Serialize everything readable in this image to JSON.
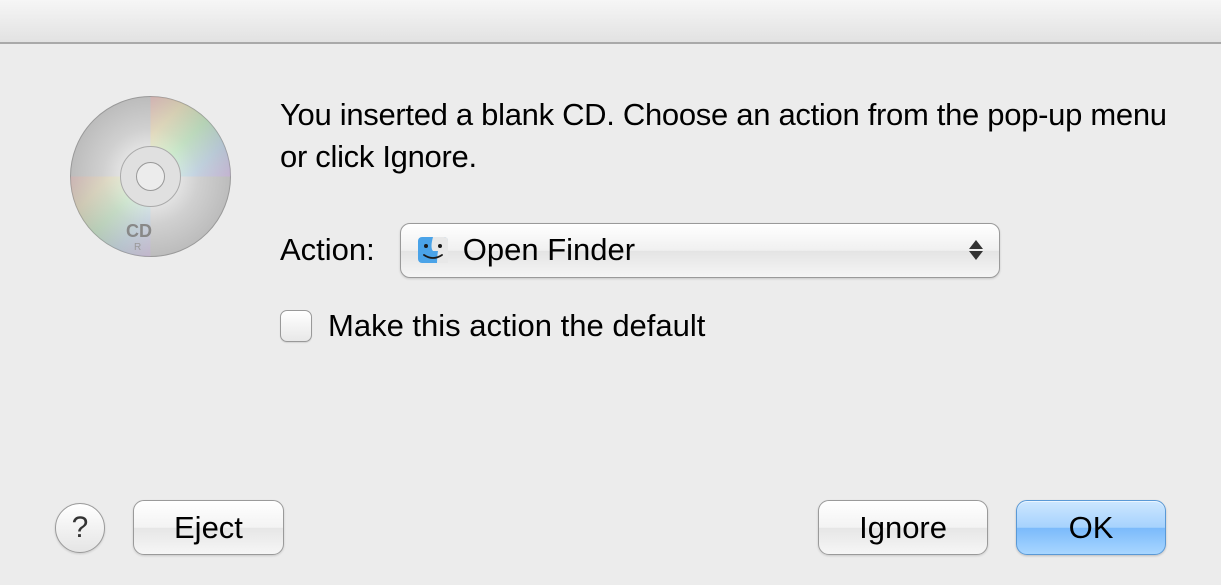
{
  "dialog": {
    "message": "You inserted a blank CD. Choose an action from the pop-up menu or click Ignore.",
    "action_label": "Action:",
    "action_selected": "Open Finder",
    "checkbox_label": "Make this action the default",
    "checkbox_checked": false,
    "disc_label": "CD",
    "disc_sublabel": "R"
  },
  "buttons": {
    "help": "?",
    "eject": "Eject",
    "ignore": "Ignore",
    "ok": "OK"
  }
}
